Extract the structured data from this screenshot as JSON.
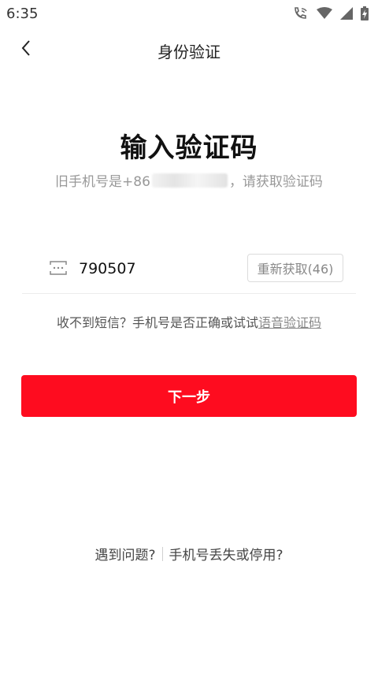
{
  "status_bar": {
    "time": "6:35",
    "icons": [
      "wifi-call-icon",
      "wifi-icon",
      "signal-icon",
      "battery-charging-icon"
    ]
  },
  "nav": {
    "back_icon": "chevron-left-icon",
    "title": "身份验证"
  },
  "main": {
    "title": "输入验证码",
    "subtitle_prefix": "旧手机号是+86 ",
    "subtitle_suffix": "，请获取验证码"
  },
  "code_field": {
    "icon": "sms-code-icon",
    "value": "790507",
    "resend_label": "重新获取(46)"
  },
  "hint": {
    "text": "收不到短信？手机号是否正确或试试",
    "voice_link": "语音验证码"
  },
  "next_button": {
    "label": "下一步"
  },
  "footer": {
    "problem_link": "遇到问题?",
    "lost_phone_link": "手机号丢失或停用?"
  },
  "colors": {
    "accent": "#fe0c1f",
    "text_primary": "#111111",
    "text_secondary": "#999999"
  }
}
